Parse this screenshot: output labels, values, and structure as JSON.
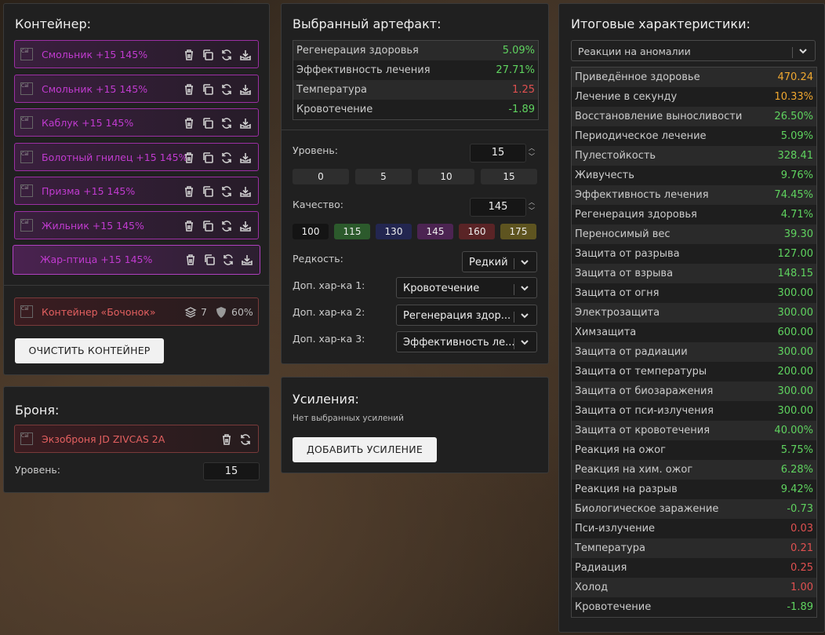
{
  "container": {
    "title": "Контейнер:",
    "items": [
      {
        "name": "Смольник +15 145%"
      },
      {
        "name": "Смольник +15 145%"
      },
      {
        "name": "Каблук +15 145%"
      },
      {
        "name": "Болотный гнилец +15 145%"
      },
      {
        "name": "Призма +15 145%"
      },
      {
        "name": "Жильник +15 145%"
      },
      {
        "name": "Жар-птица +15 145%"
      }
    ],
    "img_alt": "Cal",
    "box": {
      "name": "Контейнер «Бочонок»",
      "slots": "7",
      "protection": "60%"
    },
    "clear_label": "ОЧИСТИТЬ КОНТЕЙНЕР"
  },
  "armor": {
    "title": "Броня:",
    "name": "Экзоброня JD ZIVCAS 2A",
    "level_label": "Уровень:",
    "level": "15"
  },
  "artifact": {
    "title": "Выбранный артефакт:",
    "stats": [
      {
        "name": "Регенерация здоровья",
        "value": "5.09%",
        "color": "g"
      },
      {
        "name": "Эффективность лечения",
        "value": "27.71%",
        "color": "g"
      },
      {
        "name": "Температура",
        "value": "1.25",
        "color": "r"
      },
      {
        "name": "Кровотечение",
        "value": "-1.89",
        "color": "g"
      }
    ],
    "level_label": "Уровень:",
    "level": "15",
    "level_presets": [
      "0",
      "5",
      "10",
      "15"
    ],
    "quality_label": "Качество:",
    "quality": "145",
    "quality_presets": [
      {
        "v": "100",
        "bg": "#141414"
      },
      {
        "v": "115",
        "bg": "#2c5a2c"
      },
      {
        "v": "130",
        "bg": "#232650"
      },
      {
        "v": "145",
        "bg": "#4c2452"
      },
      {
        "v": "160",
        "bg": "#5a2426"
      },
      {
        "v": "175",
        "bg": "#5e5420"
      }
    ],
    "rarity_label": "Редкость:",
    "rarity": "Редкий",
    "extra1_label": "Доп. хар-ка 1:",
    "extra1": "Кровотечение",
    "extra2_label": "Доп. хар-ка 2:",
    "extra2": "Регенерация здор...",
    "extra3_label": "Доп. хар-ка 3:",
    "extra3": "Эффективность ле..."
  },
  "boosts": {
    "title": "Усиления:",
    "empty": "Нет выбранных усилений",
    "add_label": "ДОБАВИТЬ УСИЛЕНИЕ"
  },
  "totals": {
    "title": "Итоговые характеристики:",
    "filter": "Реакции на аномалии",
    "stats": [
      {
        "name": "Приведённое здоровье",
        "value": "470.24",
        "color": "o"
      },
      {
        "name": "Лечение в секунду",
        "value": "10.33%",
        "color": "o"
      },
      {
        "name": "Восстановление выносливости",
        "value": "26.50%",
        "color": "g"
      },
      {
        "name": "Периодическое лечение",
        "value": "5.09%",
        "color": "g"
      },
      {
        "name": "Пулестойкость",
        "value": "328.41",
        "color": "g"
      },
      {
        "name": "Живучесть",
        "value": "9.76%",
        "color": "g"
      },
      {
        "name": "Эффективность лечения",
        "value": "74.45%",
        "color": "g"
      },
      {
        "name": "Регенерация здоровья",
        "value": "4.71%",
        "color": "g"
      },
      {
        "name": "Переносимый вес",
        "value": "39.30",
        "color": "g"
      },
      {
        "name": "Защита от разрыва",
        "value": "127.00",
        "color": "g"
      },
      {
        "name": "Защита от взрыва",
        "value": "148.15",
        "color": "g"
      },
      {
        "name": "Защита от огня",
        "value": "300.00",
        "color": "g"
      },
      {
        "name": "Электрозащита",
        "value": "300.00",
        "color": "g"
      },
      {
        "name": "Химзащита",
        "value": "600.00",
        "color": "g"
      },
      {
        "name": "Защита от радиации",
        "value": "300.00",
        "color": "g"
      },
      {
        "name": "Защита от температуры",
        "value": "200.00",
        "color": "g"
      },
      {
        "name": "Защита от биозаражения",
        "value": "300.00",
        "color": "g"
      },
      {
        "name": "Защита от пси-излучения",
        "value": "300.00",
        "color": "g"
      },
      {
        "name": "Защита от кровотечения",
        "value": "40.00%",
        "color": "g"
      },
      {
        "name": "Реакция на ожог",
        "value": "5.75%",
        "color": "g"
      },
      {
        "name": "Реакция на хим. ожог",
        "value": "6.28%",
        "color": "g"
      },
      {
        "name": "Реакция на разрыв",
        "value": "9.42%",
        "color": "g"
      },
      {
        "name": "Биологическое заражение",
        "value": "-0.73",
        "color": "g"
      },
      {
        "name": "Пси-излучение",
        "value": "0.03",
        "color": "r"
      },
      {
        "name": "Температура",
        "value": "0.21",
        "color": "r"
      },
      {
        "name": "Радиация",
        "value": "0.25",
        "color": "r"
      },
      {
        "name": "Холод",
        "value": "1.00",
        "color": "r"
      },
      {
        "name": "Кровотечение",
        "value": "-1.89",
        "color": "g"
      }
    ]
  }
}
